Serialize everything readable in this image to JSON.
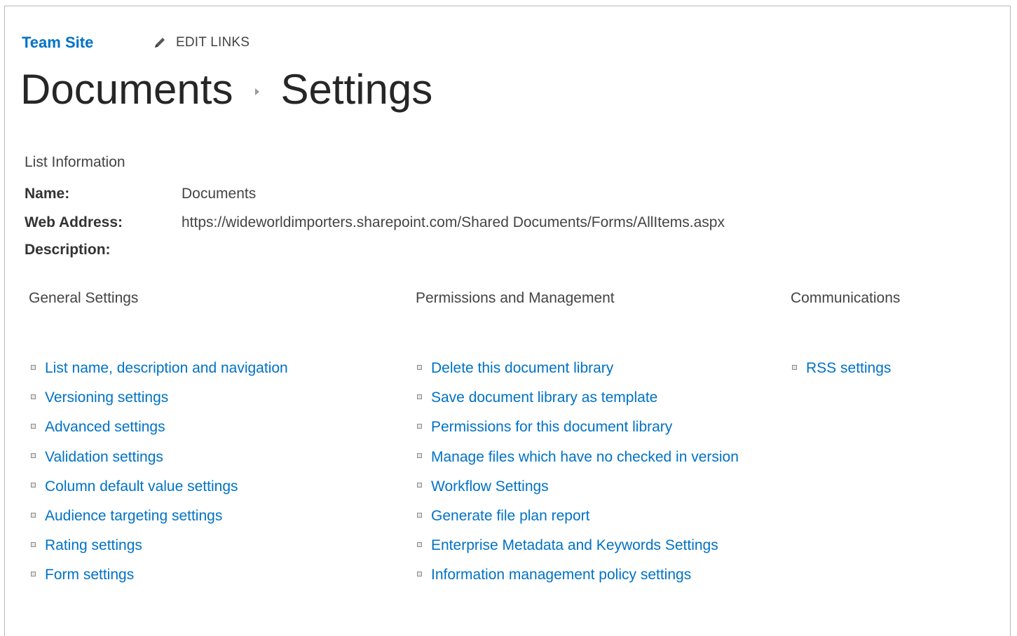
{
  "nav": {
    "site_title": "Team Site",
    "edit_links_label": "EDIT LINKS"
  },
  "breadcrumb": {
    "library": "Documents",
    "page": "Settings"
  },
  "list_info": {
    "heading": "List Information",
    "name_label": "Name:",
    "name_value": "Documents",
    "web_address_label": "Web Address:",
    "web_address_value": "https://wideworldimporters.sharepoint.com/Shared Documents/Forms/AllItems.aspx",
    "description_label": "Description:",
    "description_value": ""
  },
  "general_settings": {
    "heading": "General Settings",
    "links": [
      "List name, description and navigation",
      "Versioning settings",
      "Advanced settings",
      "Validation settings",
      "Column default value settings",
      "Audience targeting settings",
      "Rating settings",
      "Form settings"
    ]
  },
  "permissions_management": {
    "heading": "Permissions and Management",
    "links": [
      "Delete this document library",
      "Save document library as template",
      "Permissions for this document library",
      "Manage files which have no checked in version",
      "Workflow Settings",
      "Generate file plan report",
      "Enterprise Metadata and Keywords Settings",
      "Information management policy settings"
    ]
  },
  "communications": {
    "heading": "Communications",
    "links": [
      "RSS settings"
    ]
  },
  "colors": {
    "link": "#0072c6",
    "text": "#333333",
    "border": "#b8b8b8"
  }
}
